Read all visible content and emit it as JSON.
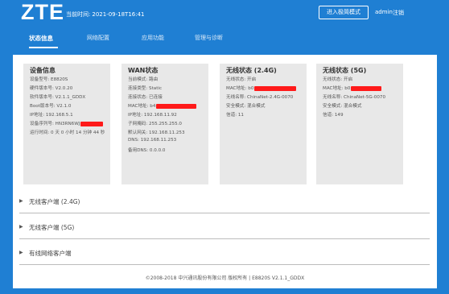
{
  "header": {
    "logo": "ZTE",
    "time_label": "当前时间:",
    "time_value": "2021-09-18T16:41",
    "mode_button": "进入极简模式",
    "user": "admin",
    "logout": "注销"
  },
  "nav": {
    "items": [
      "状态信息",
      "网络配置",
      "应用功能",
      "管理与诊断"
    ],
    "active_index": 0
  },
  "cards": {
    "device": {
      "title": "设备信息",
      "rows": [
        "设备型号: E8820S",
        "硬件版本号: V2.0.20",
        "软件版本号: V2.1.1_GDDX",
        "Boot版本号: V2.1.0",
        "IP地址: 192.168.5.1",
        "设备序列号: HN3RN6WJ",
        "运行时间: 0 天 0 小时 14 分钟 44 秒"
      ]
    },
    "wan": {
      "title": "WAN状态",
      "rows": [
        "当前模式: 路由",
        "连接类型: Static",
        "连接状态: 已连接",
        "MAC地址: b4",
        "IP地址: 192.168.11.92",
        "子网掩码: 255.255.255.0",
        "默认网关: 192.168.11.253",
        "DNS: 192.168.11.253",
        "备用DNS: 0.0.0.0"
      ]
    },
    "wifi24": {
      "title": "无线状态 (2.4G)",
      "rows": [
        "无线状态: 开启",
        "MAC地址: b0",
        "无线名称: ChinaNet-2.4G-0070",
        "安全模式: 混合模式",
        "信道: 11"
      ]
    },
    "wifi5": {
      "title": "无线状态 (5G)",
      "rows": [
        "无线状态: 开启",
        "MAC地址: b0",
        "无线名称: ChinaNet-5G-0070",
        "安全模式: 混合模式",
        "信道: 149"
      ]
    }
  },
  "sections": [
    "无线客户端 (2.4G)",
    "无线客户端 (5G)",
    "有线网络客户端"
  ],
  "footer": "©2008-2018 中兴通讯股份有限公司 版权所有  |  E8820S V2.1.1_GDDX",
  "colors": {
    "header_bg": "#1f7fd3",
    "redaction": "#ff1a1a",
    "card_bg": "#e8e8e8"
  }
}
